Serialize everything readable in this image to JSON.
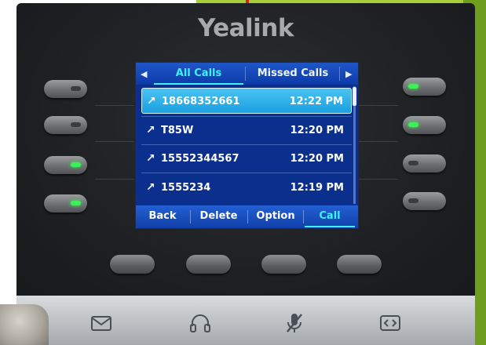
{
  "brand": "Yealink",
  "tabs": {
    "active_label": "All Calls",
    "inactive_label": "Missed Calls"
  },
  "calls": [
    {
      "number": "18668352661",
      "time": "12:22 PM",
      "selected": true
    },
    {
      "number": "T85W",
      "time": "12:20 PM",
      "selected": false
    },
    {
      "number": "15552344567",
      "time": "12:20 PM",
      "selected": false
    },
    {
      "number": "1555234",
      "time": "12:19 PM",
      "selected": false
    }
  ],
  "softkeys": {
    "back": "Back",
    "delete": "Delete",
    "option": "Option",
    "call": "Call"
  },
  "icons": {
    "arrow": "outgoing-call-arrow",
    "bottom": [
      "message-icon",
      "headset-icon",
      "mute-icon",
      "transfer-icon"
    ]
  },
  "colors": {
    "accent": "#3ff0ff",
    "screen_bg": "#0a2f8c",
    "selection": "#1b9fe0",
    "led_on": "#3cf05a"
  }
}
